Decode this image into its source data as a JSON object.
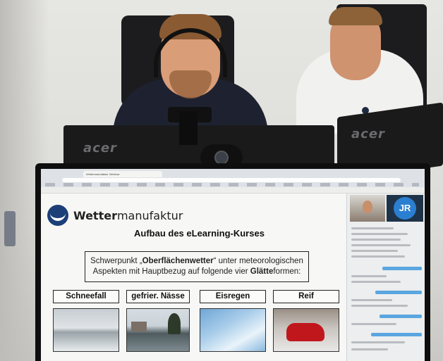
{
  "photo": {
    "monitor_brand_left": "acer",
    "monitor_brand_right": "acer"
  },
  "browser": {
    "tab_title": "Wettermanufaktur Webinar"
  },
  "slide": {
    "brand_bold": "Wetter",
    "brand_rest": "manufaktur",
    "title": "Aufbau des eLearning-Kurses",
    "focus_line1_pre": "Schwerpunkt „",
    "focus_line1_bold": "Oberflächenwetter",
    "focus_line1_post": "“ unter meteorologischen",
    "focus_line2_pre": "Aspekten mit Hauptbezug auf folgende vier ",
    "focus_line2_bold": "Glätte",
    "focus_line2_post": "formen:",
    "categories": [
      "Schneefall",
      "gefrier. Nässe",
      "Eisregen",
      "Reif"
    ]
  },
  "participant": {
    "initials": "JR"
  },
  "colors": {
    "logo": "#1c3f78",
    "avatar": "#2b7fd1",
    "chat_bubble": "#5aa6e0"
  }
}
